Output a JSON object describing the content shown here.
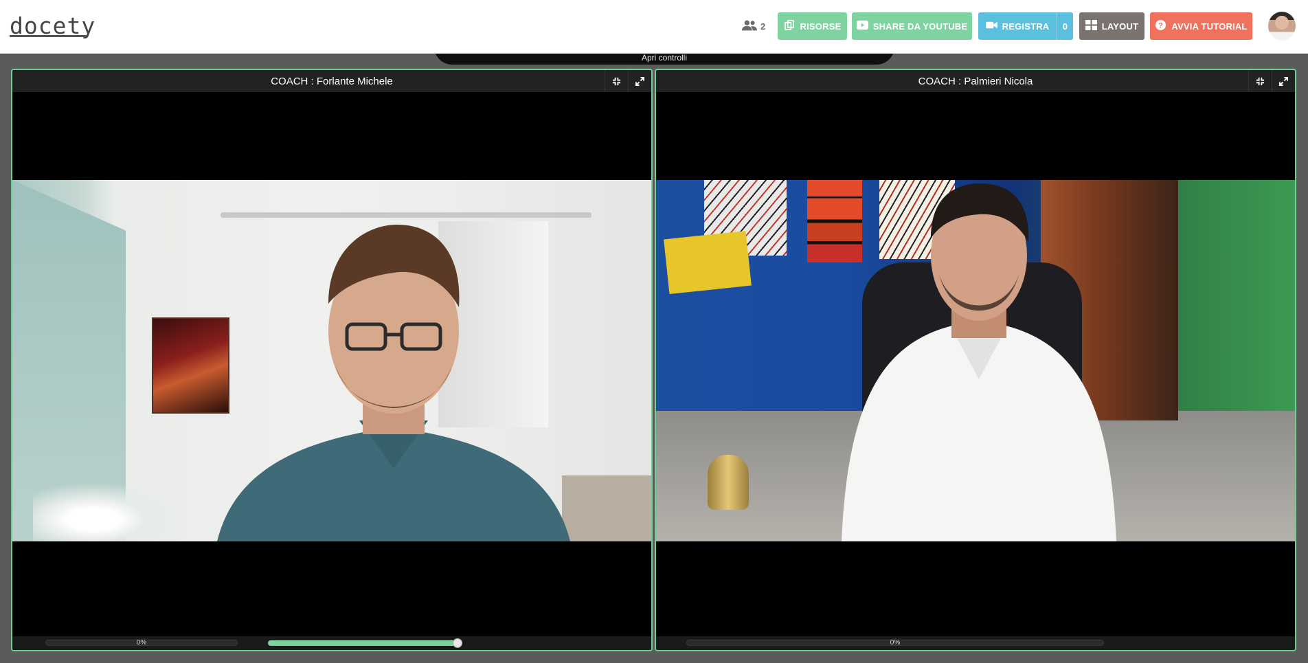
{
  "header": {
    "logo_text": "docety",
    "participants_count": "2",
    "buttons": {
      "risorse": "RISORSE",
      "share_youtube": "SHARE DA YOUTUBE",
      "registra": "REGISTRA",
      "registra_count": "0",
      "layout": "LAYOUT",
      "avvia_tutorial": "AVVIA TUTORIAL"
    }
  },
  "controls_tab": {
    "label": "Apri controlli"
  },
  "panels": [
    {
      "title": "COACH : Forlante Michele",
      "progress_label": "0%",
      "volume_level": 0.98
    },
    {
      "title": "COACH : Palmieri Nicola",
      "progress_label": "0%"
    }
  ],
  "colors": {
    "accent_green": "#7fd3a1",
    "border_green": "#6fcf97",
    "registra_blue": "#5bc0de",
    "layout_gray": "#7a7370",
    "tutorial_red": "#f0725c"
  },
  "icons": [
    "users-icon",
    "copy-icon",
    "youtube-icon",
    "video-camera-icon",
    "layout-grid-icon",
    "question-circle-icon",
    "compress-icon",
    "expand-icon"
  ]
}
